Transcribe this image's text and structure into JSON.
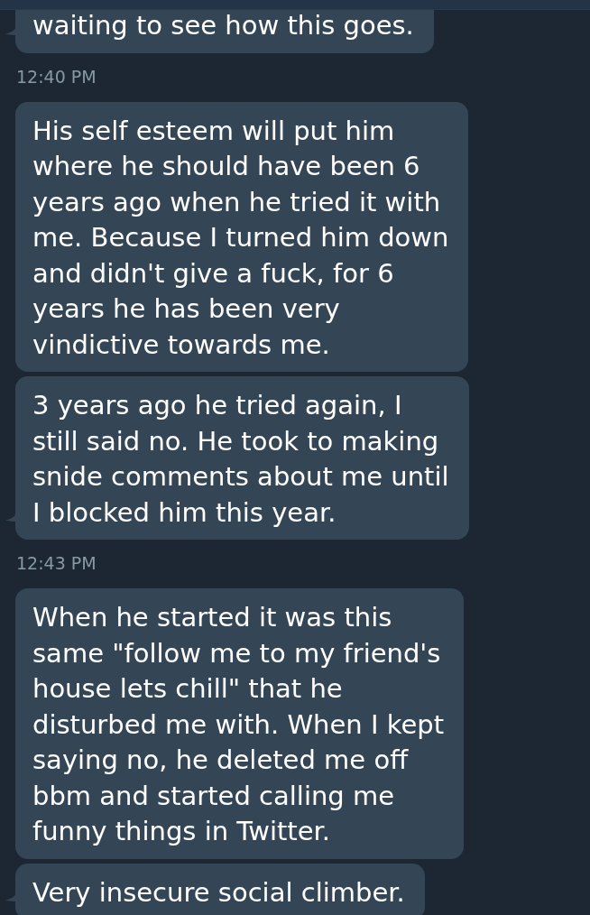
{
  "conversation": {
    "groups": [
      {
        "messages": [
          {
            "text": "waiting to see how this goes."
          }
        ],
        "timestamp": "12:40 PM"
      },
      {
        "messages": [
          {
            "text": "His self esteem will put him\nwhere he should have been 6\nyears ago when he tried it with\nme. Because I turned him down\nand didn't give a fuck, for 6\nyears he has been very\nvindictive towards me."
          },
          {
            "text": "3 years ago he tried again, I\nstill said no. He took to making\nsnide comments about me until\nI blocked him this year."
          }
        ],
        "timestamp": "12:43 PM"
      },
      {
        "messages": [
          {
            "text": "When he started it was this\nsame \"follow me to my friend's\nhouse lets chill\" that he\ndisturbed me with. When I kept\nsaying no, he deleted me off\nbbm and started calling me\nfunny things in Twitter."
          },
          {
            "text": "Very insecure social climber."
          }
        ]
      }
    ]
  }
}
